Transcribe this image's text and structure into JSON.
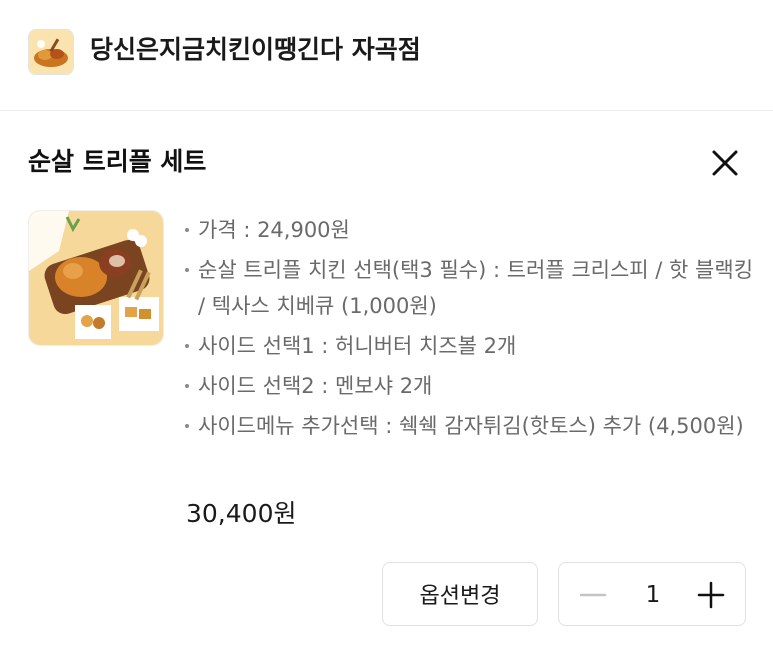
{
  "store": {
    "name": "당신은지금치킨이땡긴다 자곡점"
  },
  "product": {
    "title": "순살 트리플 세트",
    "details": [
      "가격 : 24,900원",
      "순살 트리플 치킨 선택(택3 필수) : 트러플 크리스피 / 핫 블랙킹 / 텍사스 치베큐 (1,000원)",
      "사이드 선택1 : 허니버터 치즈볼 2개",
      "사이드 선택2 : 멘보샤 2개",
      "사이드메뉴 추가선택 : 쉑쉑 감자튀김(핫토스) 추가 (4,500원)"
    ],
    "total_price": "30,400원"
  },
  "actions": {
    "option_change_label": "옵션변경",
    "quantity": "1"
  },
  "icons": {
    "close": "close-icon",
    "minus": "minus-icon",
    "plus": "plus-icon"
  },
  "colors": {
    "text_primary": "#1a1a1a",
    "text_secondary": "#6a6a6a",
    "border": "#e1e1e1"
  }
}
